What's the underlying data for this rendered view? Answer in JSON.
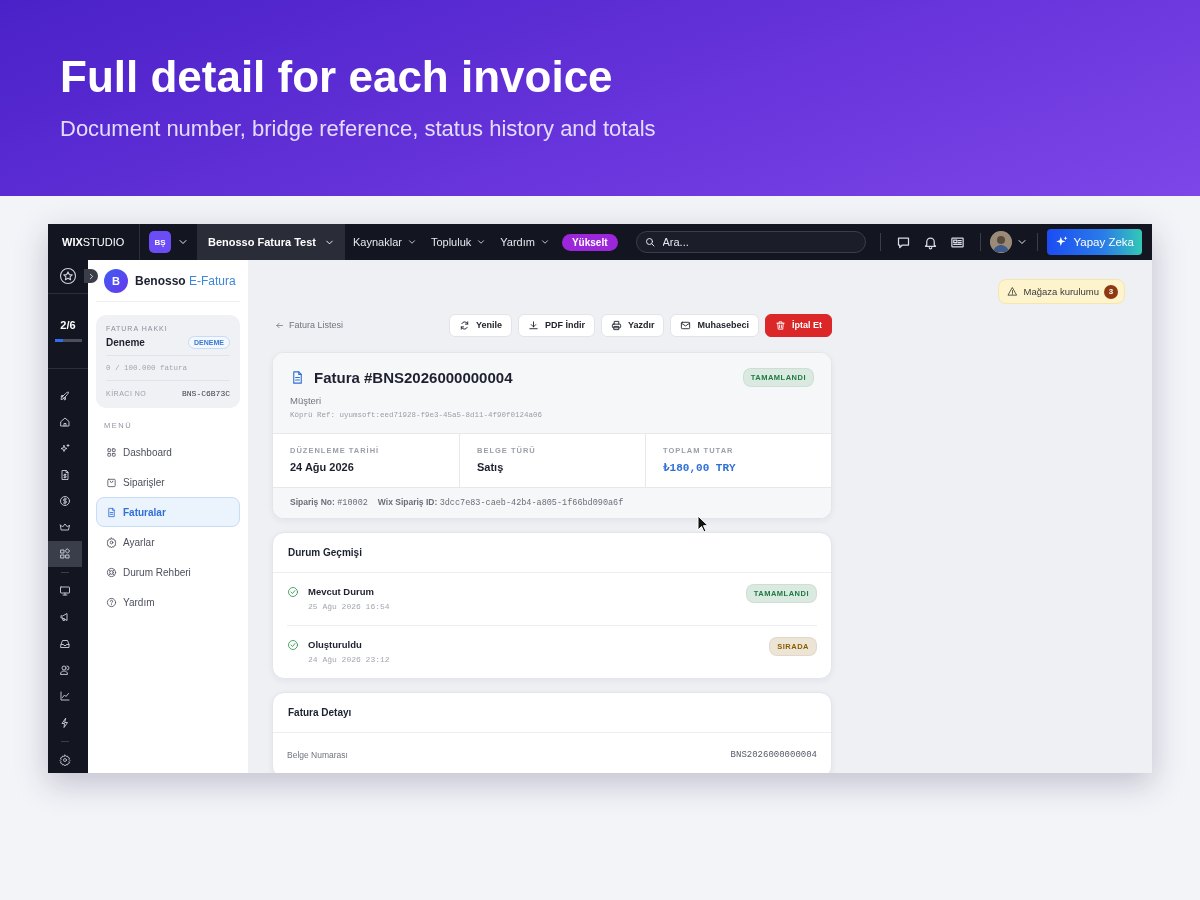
{
  "banner": {
    "title": "Full detail for each invoice",
    "subtitle": "Document number, bridge reference, status history and totals"
  },
  "topbar": {
    "logo_bold": "WIX",
    "logo_light": "STUDIO",
    "site_badge": "BŞ",
    "site_name": "Benosso Fatura Test",
    "menus": [
      "Kaynaklar",
      "Topluluk",
      "Yardım"
    ],
    "upgrade": "Yükselt",
    "search": {
      "placeholder": "Ara..."
    },
    "ai_button": "Yapay Zeka"
  },
  "rail": {
    "progress": {
      "label": "2/6",
      "level": 0.33
    },
    "items": [
      {
        "selected": false
      },
      {
        "selected": false
      },
      {
        "selected": false
      },
      {
        "selected": false
      },
      {
        "selected": false
      },
      {
        "selected": false
      },
      {
        "selected": true
      },
      {
        "selected": false
      },
      {
        "selected": false
      },
      {
        "selected": false
      },
      {
        "selected": false
      },
      {
        "selected": false
      },
      {
        "selected": false
      }
    ]
  },
  "sidebar": {
    "app_initial": "B",
    "app_name": "Benosso",
    "app_name_accent": "E-Fatura",
    "plan": {
      "label": "FATURA HAKKI",
      "name": "Deneme",
      "badge": "DENEME",
      "usage": "0 / 100.000 fatura",
      "tenant_label": "KİRACI NO",
      "tenant_id": "BNS-C6B73C"
    },
    "menu_label": "MENÜ",
    "items": [
      {
        "label": "Dashboard",
        "selected": false
      },
      {
        "label": "Siparişler",
        "selected": false
      },
      {
        "label": "Faturalar",
        "selected": true
      },
      {
        "label": "Ayarlar",
        "selected": false
      },
      {
        "label": "Durum Rehberi",
        "selected": false
      },
      {
        "label": "Yardım",
        "selected": false
      }
    ]
  },
  "notice": {
    "label": "Mağaza kurulumu",
    "count": "3"
  },
  "back_link": "Fatura Listesi",
  "actions": [
    {
      "label": "Yenile",
      "kind": "refresh"
    },
    {
      "label": "PDF İndir",
      "kind": "download"
    },
    {
      "label": "Yazdır",
      "kind": "print"
    },
    {
      "label": "Muhasebeci",
      "kind": "mail"
    },
    {
      "label": "İptal Et",
      "kind": "danger"
    }
  ],
  "invoice": {
    "title": "Fatura #BNS2026000000004",
    "status": {
      "label": "TAMAMLANDI",
      "color": "#1f7a43"
    },
    "customer": "Müşteri",
    "bridge_ref": "Köprü Ref: uyumsoft:eed71928-f9e3-45a5-8d11-4f90f0124a06",
    "fields": [
      {
        "label": "DÜZENLEME TARİHİ",
        "value": "24 Ağu 2026",
        "kind": "text"
      },
      {
        "label": "BELGE TÜRÜ",
        "value": "Satış",
        "kind": "text"
      },
      {
        "label": "TOPLAM TUTAR",
        "value": "₺180,00 TRY",
        "kind": "amount"
      }
    ],
    "order_no_label": "Sipariş No:",
    "order_no": "#10002",
    "wix_order_label": "Wix Sipariş ID:",
    "wix_order_id": "3dcc7e83-caeb-42b4-a805-1f66bd090a6f"
  },
  "history": {
    "title": "Durum Geçmişi",
    "entries": [
      {
        "label": "Mevcut Durum",
        "time": "25 Ağu 2026 16:54",
        "status": "TAMAMLANDI",
        "color": "#1f7a43"
      },
      {
        "label": "Oluşturuldu",
        "time": "24 Ağu 2026 23:12",
        "status": "SIRADA",
        "color": "#8a5a00"
      }
    ]
  },
  "detail": {
    "title": "Fatura Detayı",
    "rows": [
      {
        "label": "Belge Numarası",
        "value": "BNS2026000000004"
      }
    ]
  }
}
